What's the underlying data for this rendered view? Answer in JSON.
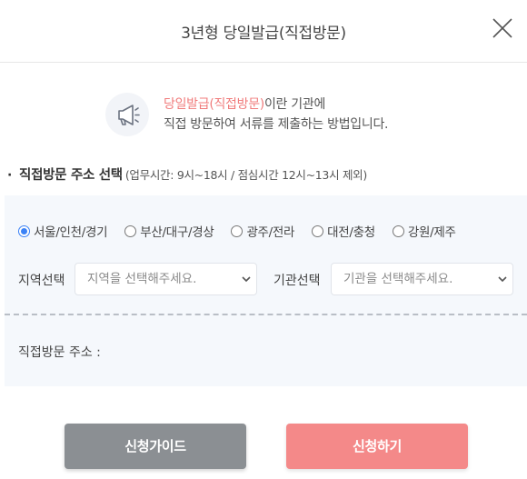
{
  "dialog": {
    "title": "3년형 당일발급(직접방문)",
    "close_icon": "close-icon"
  },
  "intro": {
    "icon": "megaphone-icon",
    "highlight": "당일발급(직접방문)",
    "line1_rest": "이란 기관에",
    "line2": "직접 방문하여 서류를 제출하는 방법입니다."
  },
  "section": {
    "bullet": "·",
    "title": "직접방문 주소 선택",
    "hours": "(업무시간: 9시~18시 / 점심시간 12시~13시 제외)"
  },
  "regions": {
    "selected": "서울/인천/경기",
    "options": [
      "서울/인천/경기",
      "부산/대구/경상",
      "광주/전라",
      "대전/충청",
      "강원/제주"
    ]
  },
  "region_select": {
    "label": "지역선택",
    "placeholder": "지역을 선택해주세요."
  },
  "agency_select": {
    "label": "기관선택",
    "placeholder": "기관을 선택해주세요."
  },
  "address": {
    "label": "직접방문 주소 :"
  },
  "buttons": {
    "guide": "신청가이드",
    "apply": "신청하기"
  },
  "colors": {
    "highlight": "#f07b7b",
    "radio_selected": "#3b82f6",
    "guide_button": "#8b8f93",
    "apply_button": "#f48989",
    "panel_background": "#f5f8fc"
  }
}
